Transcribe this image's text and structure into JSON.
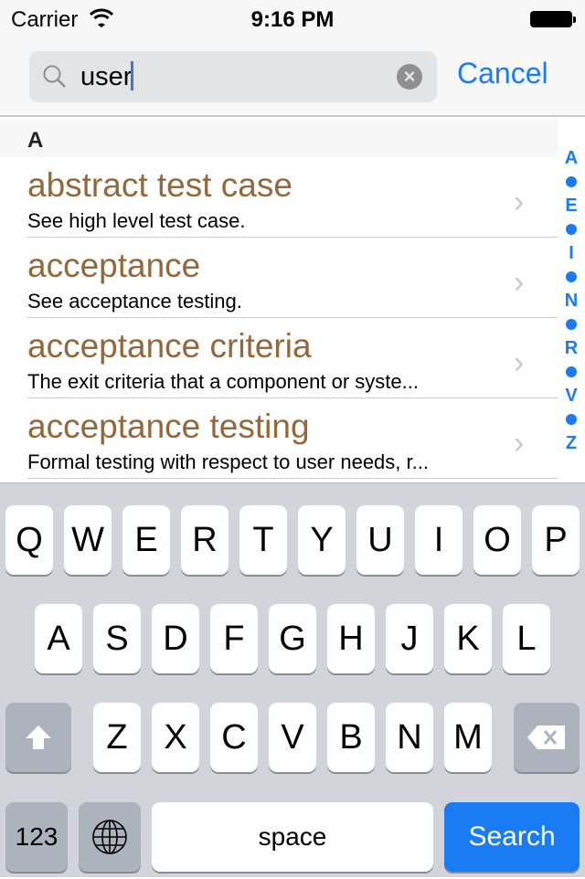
{
  "status": {
    "carrier": "Carrier",
    "time": "9:16 PM"
  },
  "search": {
    "query": "user",
    "cancel": "Cancel"
  },
  "section": "A",
  "results": [
    {
      "term": "abstract test case",
      "desc": "See high level test case."
    },
    {
      "term": "acceptance",
      "desc": "See acceptance testing."
    },
    {
      "term": "acceptance criteria",
      "desc": "The exit criteria that a component or syste..."
    },
    {
      "term": "acceptance testing",
      "desc": "Formal testing with respect to user needs, r..."
    }
  ],
  "index": [
    "A",
    "•",
    "E",
    "•",
    "I",
    "•",
    "N",
    "•",
    "R",
    "•",
    "V",
    "•",
    "Z"
  ],
  "keyboard": {
    "row1": [
      "Q",
      "W",
      "E",
      "R",
      "T",
      "Y",
      "U",
      "I",
      "O",
      "P"
    ],
    "row2": [
      "A",
      "S",
      "D",
      "F",
      "G",
      "H",
      "J",
      "K",
      "L"
    ],
    "row3": [
      "Z",
      "X",
      "C",
      "V",
      "B",
      "N",
      "M"
    ],
    "numbers": "123",
    "space": "space",
    "search": "Search"
  },
  "colors": {
    "accent": "#1a7cf5",
    "term": "#94683a"
  }
}
